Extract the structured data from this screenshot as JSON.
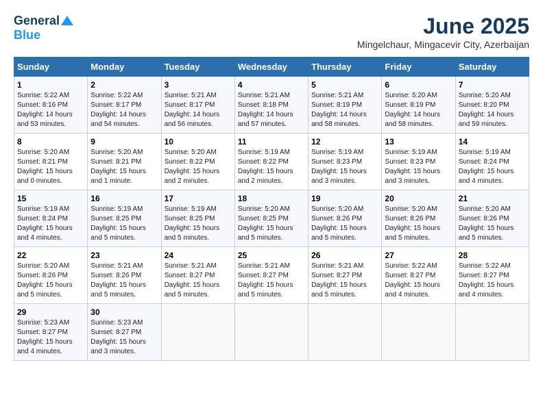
{
  "logo": {
    "general": "General",
    "blue": "Blue"
  },
  "title": "June 2025",
  "location": "Mingelchaur, Mingacevir City, Azerbaijan",
  "weekdays": [
    "Sunday",
    "Monday",
    "Tuesday",
    "Wednesday",
    "Thursday",
    "Friday",
    "Saturday"
  ],
  "weeks": [
    [
      {
        "day": "1",
        "sunrise": "5:22 AM",
        "sunset": "8:16 PM",
        "daylight": "14 hours and 53 minutes."
      },
      {
        "day": "2",
        "sunrise": "5:22 AM",
        "sunset": "8:17 PM",
        "daylight": "14 hours and 54 minutes."
      },
      {
        "day": "3",
        "sunrise": "5:21 AM",
        "sunset": "8:17 PM",
        "daylight": "14 hours and 56 minutes."
      },
      {
        "day": "4",
        "sunrise": "5:21 AM",
        "sunset": "8:18 PM",
        "daylight": "14 hours and 57 minutes."
      },
      {
        "day": "5",
        "sunrise": "5:21 AM",
        "sunset": "8:19 PM",
        "daylight": "14 hours and 58 minutes."
      },
      {
        "day": "6",
        "sunrise": "5:20 AM",
        "sunset": "8:19 PM",
        "daylight": "14 hours and 58 minutes."
      },
      {
        "day": "7",
        "sunrise": "5:20 AM",
        "sunset": "8:20 PM",
        "daylight": "14 hours and 59 minutes."
      }
    ],
    [
      {
        "day": "8",
        "sunrise": "5:20 AM",
        "sunset": "8:21 PM",
        "daylight": "15 hours and 0 minutes."
      },
      {
        "day": "9",
        "sunrise": "5:20 AM",
        "sunset": "8:21 PM",
        "daylight": "15 hours and 1 minute."
      },
      {
        "day": "10",
        "sunrise": "5:20 AM",
        "sunset": "8:22 PM",
        "daylight": "15 hours and 2 minutes."
      },
      {
        "day": "11",
        "sunrise": "5:19 AM",
        "sunset": "8:22 PM",
        "daylight": "15 hours and 2 minutes."
      },
      {
        "day": "12",
        "sunrise": "5:19 AM",
        "sunset": "8:23 PM",
        "daylight": "15 hours and 3 minutes."
      },
      {
        "day": "13",
        "sunrise": "5:19 AM",
        "sunset": "8:23 PM",
        "daylight": "15 hours and 3 minutes."
      },
      {
        "day": "14",
        "sunrise": "5:19 AM",
        "sunset": "8:24 PM",
        "daylight": "15 hours and 4 minutes."
      }
    ],
    [
      {
        "day": "15",
        "sunrise": "5:19 AM",
        "sunset": "8:24 PM",
        "daylight": "15 hours and 4 minutes."
      },
      {
        "day": "16",
        "sunrise": "5:19 AM",
        "sunset": "8:25 PM",
        "daylight": "15 hours and 5 minutes."
      },
      {
        "day": "17",
        "sunrise": "5:19 AM",
        "sunset": "8:25 PM",
        "daylight": "15 hours and 5 minutes."
      },
      {
        "day": "18",
        "sunrise": "5:20 AM",
        "sunset": "8:25 PM",
        "daylight": "15 hours and 5 minutes."
      },
      {
        "day": "19",
        "sunrise": "5:20 AM",
        "sunset": "8:26 PM",
        "daylight": "15 hours and 5 minutes."
      },
      {
        "day": "20",
        "sunrise": "5:20 AM",
        "sunset": "8:26 PM",
        "daylight": "15 hours and 5 minutes."
      },
      {
        "day": "21",
        "sunrise": "5:20 AM",
        "sunset": "8:26 PM",
        "daylight": "15 hours and 5 minutes."
      }
    ],
    [
      {
        "day": "22",
        "sunrise": "5:20 AM",
        "sunset": "8:26 PM",
        "daylight": "15 hours and 5 minutes."
      },
      {
        "day": "23",
        "sunrise": "5:21 AM",
        "sunset": "8:26 PM",
        "daylight": "15 hours and 5 minutes."
      },
      {
        "day": "24",
        "sunrise": "5:21 AM",
        "sunset": "8:27 PM",
        "daylight": "15 hours and 5 minutes."
      },
      {
        "day": "25",
        "sunrise": "5:21 AM",
        "sunset": "8:27 PM",
        "daylight": "15 hours and 5 minutes."
      },
      {
        "day": "26",
        "sunrise": "5:21 AM",
        "sunset": "8:27 PM",
        "daylight": "15 hours and 5 minutes."
      },
      {
        "day": "27",
        "sunrise": "5:22 AM",
        "sunset": "8:27 PM",
        "daylight": "15 hours and 4 minutes."
      },
      {
        "day": "28",
        "sunrise": "5:22 AM",
        "sunset": "8:27 PM",
        "daylight": "15 hours and 4 minutes."
      }
    ],
    [
      {
        "day": "29",
        "sunrise": "5:23 AM",
        "sunset": "8:27 PM",
        "daylight": "15 hours and 4 minutes."
      },
      {
        "day": "30",
        "sunrise": "5:23 AM",
        "sunset": "8:27 PM",
        "daylight": "15 hours and 3 minutes."
      },
      null,
      null,
      null,
      null,
      null
    ]
  ]
}
